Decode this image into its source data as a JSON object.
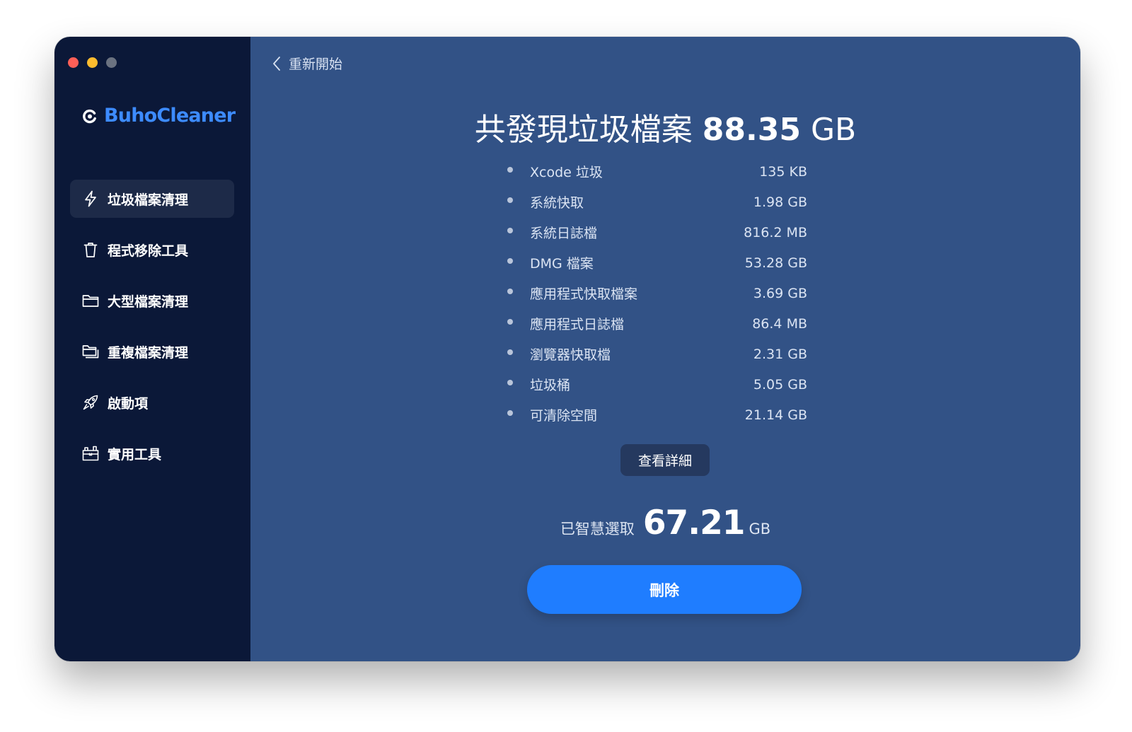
{
  "window": {
    "traffic_lights": [
      {
        "name": "close",
        "color": "#ff5f57"
      },
      {
        "name": "minimize",
        "color": "#febc2e"
      },
      {
        "name": "zoom",
        "color": "#6b7280"
      }
    ]
  },
  "brand": {
    "name": "BuhoCleaner",
    "color": "#3d8bff"
  },
  "sidebar": {
    "items": [
      {
        "label": "垃圾檔案清理",
        "icon": "lightning-icon",
        "active": true
      },
      {
        "label": "程式移除工具",
        "icon": "trash-icon",
        "active": false
      },
      {
        "label": "大型檔案清理",
        "icon": "folder-icon",
        "active": false
      },
      {
        "label": "重複檔案清理",
        "icon": "duplicate-folder-icon",
        "active": false
      },
      {
        "label": "啟動項",
        "icon": "rocket-icon",
        "active": false
      },
      {
        "label": "實用工具",
        "icon": "toolbox-icon",
        "active": false
      }
    ]
  },
  "header": {
    "back_label": "重新開始",
    "back_icon": "chevron-left-icon"
  },
  "summary": {
    "title_prefix": "共發現垃圾檔案",
    "total_value": "88.35",
    "total_unit": "GB"
  },
  "junk_items": [
    {
      "name": "Xcode 垃圾",
      "size": "135 KB"
    },
    {
      "name": "系統快取",
      "size": "1.98 GB"
    },
    {
      "name": "系統日誌檔",
      "size": "816.2 MB"
    },
    {
      "name": "DMG 檔案",
      "size": "53.28 GB"
    },
    {
      "name": "應用程式快取檔案",
      "size": "3.69 GB"
    },
    {
      "name": "應用程式日誌檔",
      "size": "86.4 MB"
    },
    {
      "name": "瀏覽器快取檔",
      "size": "2.31 GB"
    },
    {
      "name": "垃圾桶",
      "size": "5.05 GB"
    },
    {
      "name": "可清除空間",
      "size": "21.14 GB"
    }
  ],
  "details_button": {
    "label": "查看詳細"
  },
  "selected": {
    "label": "已智慧選取",
    "value": "67.21",
    "unit": "GB"
  },
  "delete_button": {
    "label": "刪除",
    "color": "#1f7dff"
  },
  "colors": {
    "sidebar_bg": "#0b1838",
    "main_bg": "#325286",
    "active_item_bg": "#1d2a48"
  }
}
